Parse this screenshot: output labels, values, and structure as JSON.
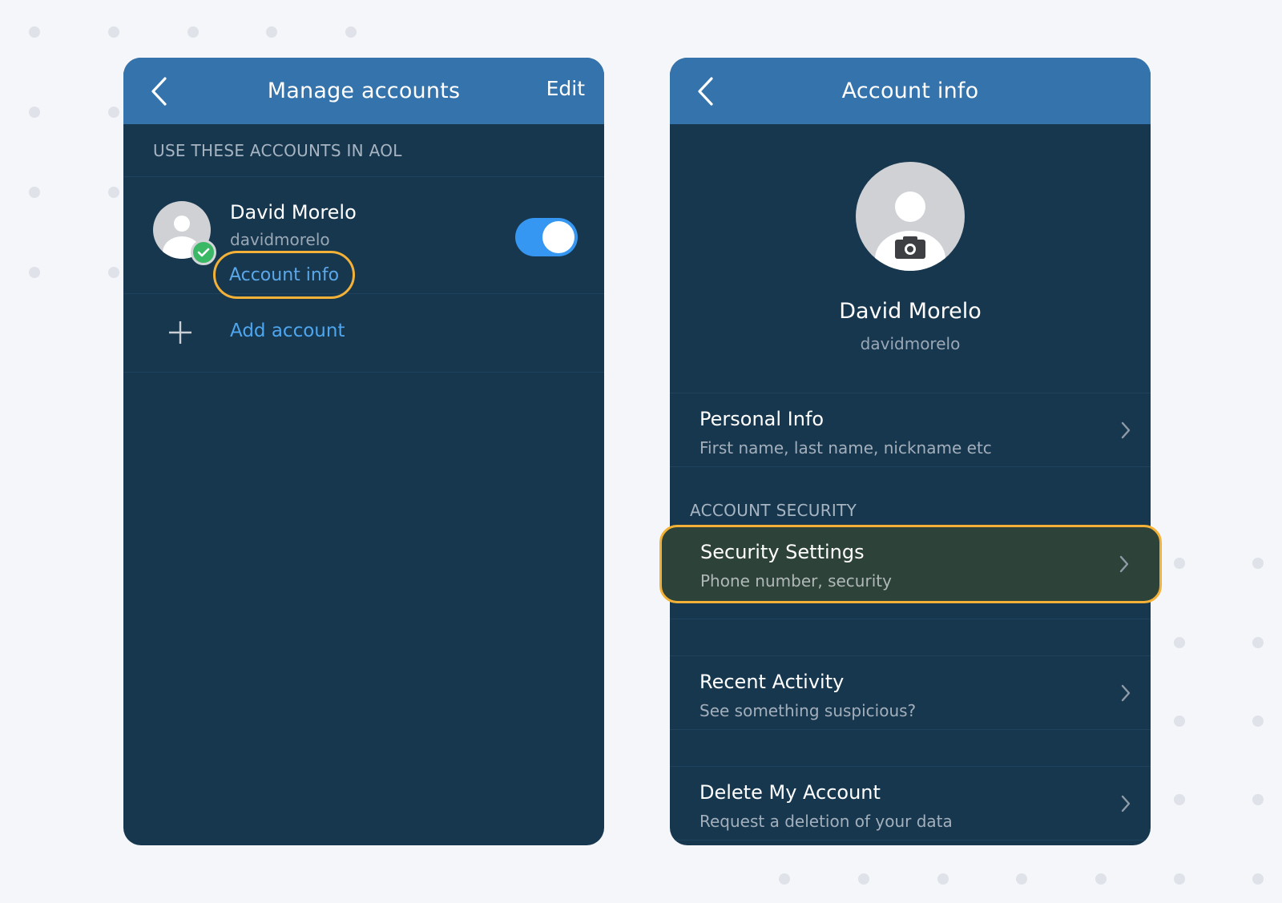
{
  "left": {
    "title": "Manage accounts",
    "edit_label": "Edit",
    "section_header": "USE THESE ACCOUNTS IN AOL",
    "account": {
      "name": "David Morelo",
      "username": "davidmorelo",
      "info_link": "Account info",
      "enabled": true
    },
    "add_account_label": "Add account"
  },
  "right": {
    "title": "Account info",
    "profile": {
      "name": "David Morelo",
      "username": "davidmorelo"
    },
    "personal_info": {
      "title": "Personal Info",
      "subtitle": "First name, last name, nickname etc"
    },
    "security_header": "ACCOUNT SECURITY",
    "security_settings": {
      "title": "Security Settings",
      "subtitle": "Phone number, security"
    },
    "recent_activity": {
      "title": "Recent Activity",
      "subtitle": "See something suspicious?"
    },
    "delete_account": {
      "title": "Delete My Account",
      "subtitle": "Request a deletion of your data"
    }
  },
  "colors": {
    "header_blue": "#3473ab",
    "panel_navy": "#17374f",
    "highlight_orange": "#f3b237",
    "link_blue": "#4ea6ef",
    "toggle_blue": "#3597f1",
    "success_green": "#3bb866"
  },
  "icons": [
    "back-arrow-icon",
    "check-icon",
    "plus-icon",
    "camera-icon",
    "chevron-right-icon"
  ]
}
